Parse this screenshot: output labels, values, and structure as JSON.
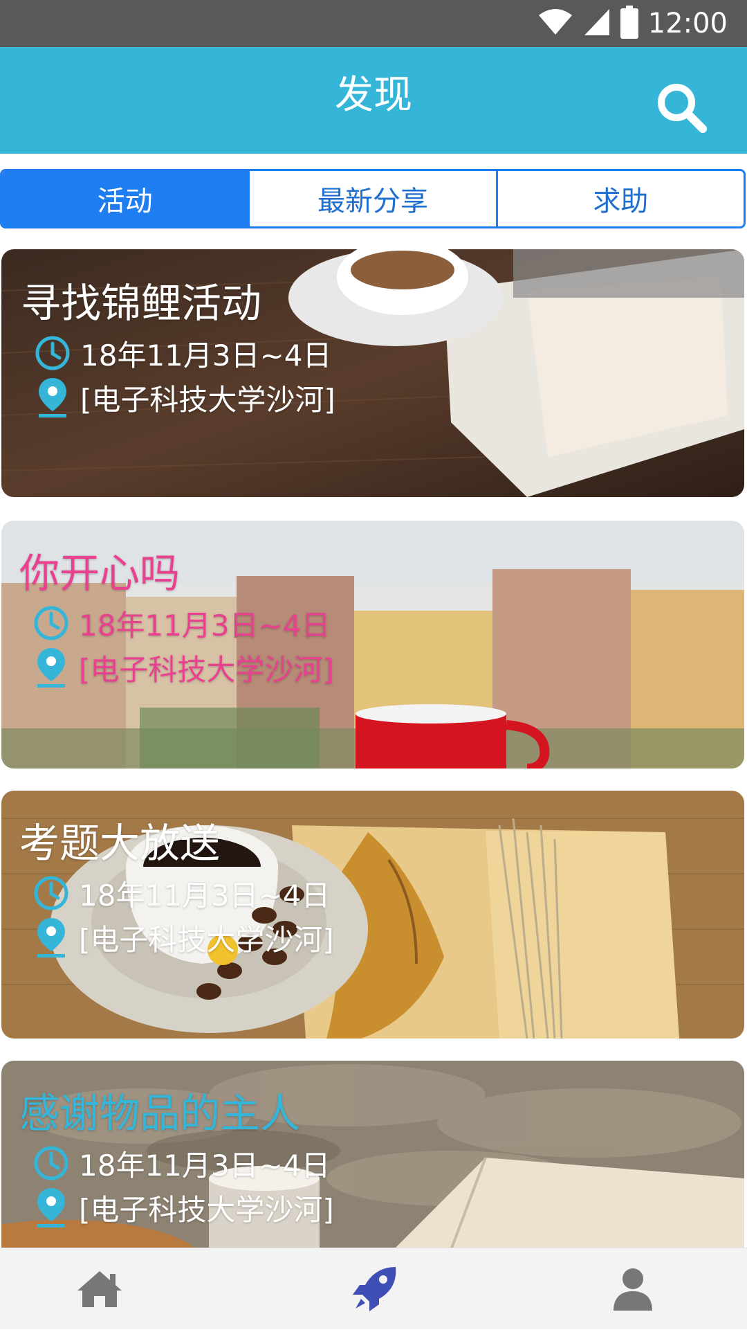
{
  "status_bar": {
    "time": "12:00",
    "icons": [
      "wifi-icon",
      "signal-icon",
      "battery-icon"
    ],
    "color": "#595959"
  },
  "header": {
    "title": "发现",
    "color": "#35b6d9",
    "search_icon": "search-icon"
  },
  "tabs": [
    {
      "label": "活动",
      "active": true
    },
    {
      "label": "最新分享",
      "active": false
    },
    {
      "label": "求助",
      "active": false
    }
  ],
  "tab_accent": "#1e7df0",
  "cards": [
    {
      "title": "寻找锦鲤活动",
      "date": "18年11月3日~4日",
      "location": "[电子科技大学沙河]",
      "text_color": "#ffffff",
      "image": "coffee cup and magazine on wooden table"
    },
    {
      "title": "你开心吗",
      "date": "18年11月3日~4日",
      "location": "[电子科技大学沙河]",
      "text_color": "#e8418f",
      "image": "red cup with blurred city buildings"
    },
    {
      "title": "考题大放送",
      "date": "18年11月3日~4日",
      "location": "[电子科技大学沙河]",
      "text_color": "#ffffff",
      "image": "coffee, beans, dried leaves and open book on burlap"
    },
    {
      "title": "感谢物品的主人",
      "date": "18年11月3日~4日",
      "location": "[电子科技大学沙河]",
      "text_color": "#35b6d9",
      "image": "knitted blanket, drink and open book"
    }
  ],
  "icon_accent": "#35b6d9",
  "bottom_nav": [
    {
      "icon": "home-icon",
      "active": false
    },
    {
      "icon": "rocket-icon",
      "active": true
    },
    {
      "icon": "user-icon",
      "active": false
    }
  ]
}
